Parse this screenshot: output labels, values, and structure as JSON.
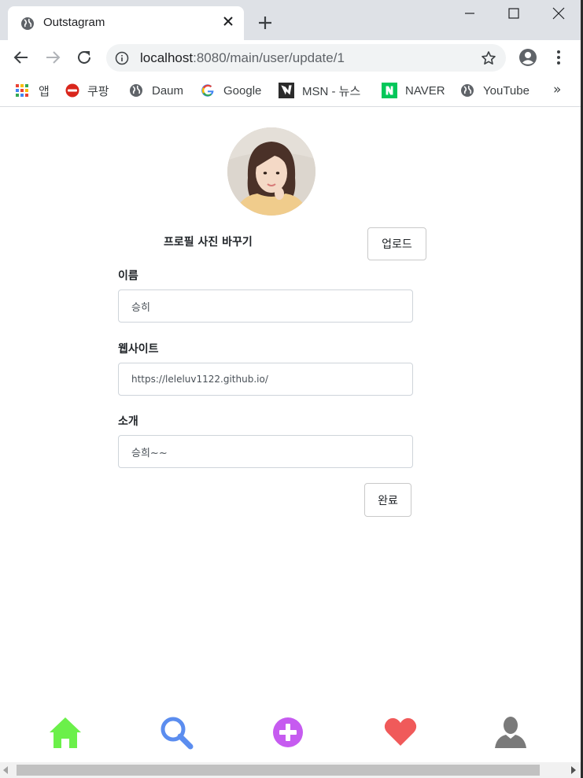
{
  "browser": {
    "tab_title": "Outstagram",
    "url_host": "localhost",
    "url_path": ":8080/main/user/update/1"
  },
  "bookmarks": [
    {
      "label": "앱",
      "icon": "apps-grid-icon"
    },
    {
      "label": "쿠팡",
      "icon": "coupang-icon"
    },
    {
      "label": "Daum",
      "icon": "globe-icon"
    },
    {
      "label": "Google",
      "icon": "google-icon"
    },
    {
      "label": "MSN - 뉴스",
      "icon": "msn-icon"
    },
    {
      "label": "NAVER",
      "icon": "naver-icon"
    },
    {
      "label": "YouTube",
      "icon": "globe-icon"
    }
  ],
  "bookmarks_more": "»",
  "profile": {
    "change_photo_label": "프로필 사진 바꾸기",
    "upload_label": "업로드"
  },
  "form": {
    "name_label": "이름",
    "name_value": "승히",
    "website_label": "웹사이트",
    "website_value": "https://leleluv1122.github.io/",
    "bio_label": "소개",
    "bio_value": "승희~~",
    "submit_label": "완료"
  },
  "bottom_nav": [
    {
      "name": "home-icon",
      "color": "#6bf04a"
    },
    {
      "name": "search-icon",
      "color": "#5b8def"
    },
    {
      "name": "add-icon",
      "color": "#c65bf0"
    },
    {
      "name": "heart-icon",
      "color": "#f05a5a"
    },
    {
      "name": "user-icon",
      "color": "#7a7a7a"
    }
  ]
}
